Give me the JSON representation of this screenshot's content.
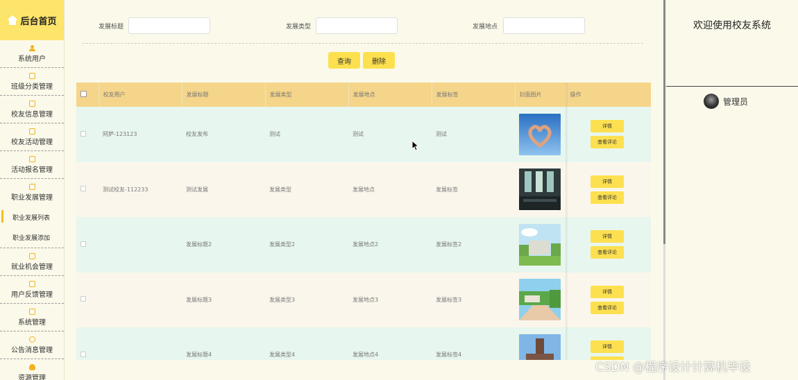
{
  "sidebar": {
    "home_label": "后台首页",
    "menu": [
      {
        "label": "系统用户",
        "icon": "user-icon"
      },
      {
        "label": "班级分类管理",
        "icon": "edit-icon"
      },
      {
        "label": "校友信息管理",
        "icon": "edit-icon"
      },
      {
        "label": "校友活动管理",
        "icon": "edit-icon"
      },
      {
        "label": "活动报名管理",
        "icon": "edit-icon"
      },
      {
        "label": "职业发展管理",
        "icon": "edit-icon"
      }
    ],
    "submenu": [
      {
        "label": "职业发展列表",
        "active": true
      },
      {
        "label": "职业发展添加",
        "active": false
      }
    ],
    "menu2": [
      {
        "label": "就业机会管理",
        "icon": "edit-icon"
      },
      {
        "label": "用户反馈管理",
        "icon": "edit-icon"
      },
      {
        "label": "系统管理",
        "icon": "image-icon"
      },
      {
        "label": "公告消息管理",
        "icon": "info-icon"
      },
      {
        "label": "资源管理",
        "icon": "bulb-icon"
      }
    ]
  },
  "search": {
    "title_label": "发展标题",
    "type_label": "发展类型",
    "location_label": "发展地点",
    "title_value": "",
    "type_value": "",
    "location_value": ""
  },
  "buttons": {
    "query": "查询",
    "delete": "删除"
  },
  "table": {
    "headers": [
      "校友用户",
      "发展标题",
      "发展类型",
      "发展地点",
      "发展标签",
      "封面图片",
      "操作"
    ],
    "rows": [
      {
        "user": "阿萨-123123",
        "title": "校友发布",
        "type": "测试",
        "location": "测试",
        "tag": "测试",
        "image": "hands-heart-sky"
      },
      {
        "user": "测试校友-112233",
        "title": "测试发展",
        "type": "发展类型",
        "location": "发展地点",
        "tag": "发展标签",
        "image": "dark-interior"
      },
      {
        "user": "",
        "title": "发展标题2",
        "type": "发展类型2",
        "location": "发展地点2",
        "tag": "发展标签2",
        "image": "campus-green"
      },
      {
        "user": "",
        "title": "发展标题3",
        "type": "发展类型3",
        "location": "发展地点3",
        "tag": "发展标签3",
        "image": "campus-road"
      },
      {
        "user": "",
        "title": "发展标题4",
        "type": "发展类型4",
        "location": "发展地点4",
        "tag": "发展标签4",
        "image": "campus-tower"
      }
    ],
    "action_detail": "详情",
    "action_comments": "查看评论"
  },
  "right_panel": {
    "welcome": "欢迎使用校友系统",
    "admin_name": "管理员"
  },
  "watermark": "CSDN @程序设计计算机毕设",
  "colors": {
    "accent": "#fde04f",
    "header_bg": "#f5d58a",
    "row_odd": "#e7f6ee",
    "row_even": "#fbf6ec",
    "page_bg": "#fbf9ea"
  }
}
